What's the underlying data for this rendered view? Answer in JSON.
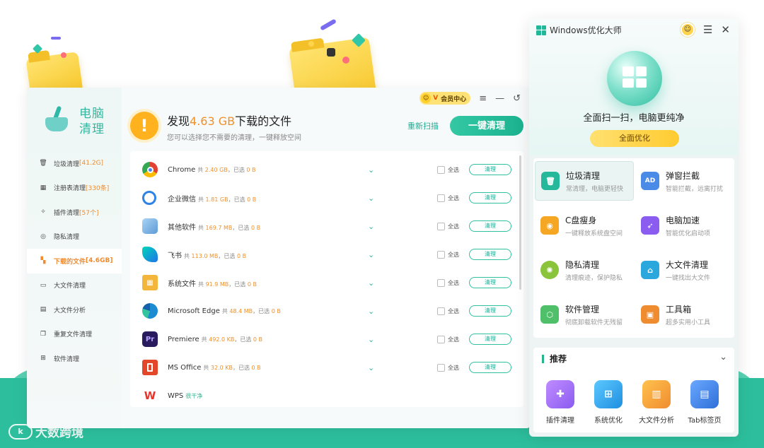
{
  "brand": {
    "logo_text": "k",
    "name": "大数跨境"
  },
  "main": {
    "app_name_line1": "电脑",
    "app_name_line2": "清理",
    "topbar": {
      "vip_badge": "V",
      "vip_label": "会员中心",
      "menu_icon": "≡",
      "minimize_icon": "—",
      "back_icon": "↺"
    },
    "sidebar": [
      {
        "label": "垃圾清理",
        "count": "[41.2G]",
        "icon": "trash-icon"
      },
      {
        "label": "注册表清理",
        "count": "[330条]",
        "icon": "registry-icon"
      },
      {
        "label": "插件清理",
        "count": "[57个]",
        "icon": "plugin-icon"
      },
      {
        "label": "隐私清理",
        "count": "",
        "icon": "privacy-icon"
      },
      {
        "label": "下载的文件",
        "count": "[4.6GB]",
        "icon": "download-icon"
      },
      {
        "label": "大文件清理",
        "count": "",
        "icon": "folder-icon"
      },
      {
        "label": "大文件分析",
        "count": "",
        "icon": "chart-icon"
      },
      {
        "label": "重复文件清理",
        "count": "",
        "icon": "duplicate-icon"
      },
      {
        "label": "软件清理",
        "count": "",
        "icon": "software-icon"
      }
    ],
    "header": {
      "title_prefix": "发现",
      "title_size": "4.63 GB",
      "title_suffix": "下载的文件",
      "subtitle": "您可以选择您不需要的清理，一键释放空间",
      "rescan": "重新扫描",
      "clean_all": "一键清理"
    },
    "rows": [
      {
        "name": "Chrome",
        "total_label": "共",
        "total": "2.40 GB",
        "sep": "，",
        "selected_label": "已选",
        "selected": "0 B",
        "select_all": "全选",
        "clean": "清理",
        "icon_text": "",
        "color": "#e34133"
      },
      {
        "name": "企业微信",
        "total_label": "共",
        "total": "1.81 GB",
        "sep": "，",
        "selected_label": "已选",
        "selected": "0 B",
        "select_all": "全选",
        "clean": "清理",
        "icon_text": "",
        "color": "#2f83e6"
      },
      {
        "name": "其他软件",
        "total_label": "共",
        "total": "169.7 MB",
        "sep": "，",
        "selected_label": "已选",
        "selected": "0 B",
        "select_all": "全选",
        "clean": "清理",
        "icon_text": "",
        "color": "#7eb5e4"
      },
      {
        "name": "飞书",
        "total_label": "共",
        "total": "113.0 MB",
        "sep": "，",
        "selected_label": "已选",
        "selected": "0 B",
        "select_all": "全选",
        "clean": "清理",
        "icon_text": "",
        "color": "#1f74e8"
      },
      {
        "name": "系统文件",
        "total_label": "共",
        "total": "91.9 MB",
        "sep": "，",
        "selected_label": "已选",
        "selected": "0 B",
        "select_all": "全选",
        "clean": "清理",
        "icon_text": "",
        "color": "#f3b53a"
      },
      {
        "name": "Microsoft Edge",
        "total_label": "共",
        "total": "48.4 MB",
        "sep": "，",
        "selected_label": "已选",
        "selected": "0 B",
        "select_all": "全选",
        "clean": "清理",
        "icon_text": "",
        "color": "#1d8bd1"
      },
      {
        "name": "Premiere",
        "total_label": "共",
        "total": "492.0 KB",
        "sep": "，",
        "selected_label": "已选",
        "selected": "0 B",
        "select_all": "全选",
        "clean": "清理",
        "icon_text": "Pr",
        "color": "#2a1b5e"
      },
      {
        "name": "MS Office",
        "total_label": "共",
        "total": "32.0 KB",
        "sep": "，",
        "selected_label": "已选",
        "selected": "0 B",
        "select_all": "全选",
        "clean": "清理",
        "icon_text": "",
        "color": "#e2472a"
      },
      {
        "name": "WPS",
        "status": "很干净",
        "icon_text": "W",
        "color": "#e8352b"
      }
    ]
  },
  "right": {
    "title": "Windows优化大师",
    "slogan": "全面扫一扫，电脑更纯净",
    "optimize": "全面优化",
    "features": [
      {
        "title": "垃圾清理",
        "desc": "常清理，电脑更轻快",
        "color": "#26b89a",
        "icon": "trash-can-icon"
      },
      {
        "title": "弹窗拦截",
        "desc": "智能拦截，远离打扰",
        "color": "#4a8be8",
        "icon": "ad-block-icon",
        "icon_text": "AD"
      },
      {
        "title": "C盘瘦身",
        "desc": "一键释放系统盘空间",
        "color": "#f5a623",
        "icon": "disk-slim-icon"
      },
      {
        "title": "电脑加速",
        "desc": "智能优化启动项",
        "color": "#8a5cf0",
        "icon": "rocket-icon"
      },
      {
        "title": "隐私清理",
        "desc": "清理痕迹，保护隐私",
        "color": "#8ac43a",
        "icon": "film-reel-icon"
      },
      {
        "title": "大文件清理",
        "desc": "一键找出大文件",
        "color": "#2aa8de",
        "icon": "broom-icon"
      },
      {
        "title": "软件管理",
        "desc": "彻底卸载软件无残留",
        "color": "#4fbf6a",
        "icon": "cube-icon"
      },
      {
        "title": "工具箱",
        "desc": "超多实用小工具",
        "color": "#f08c30",
        "icon": "toolbox-icon"
      }
    ],
    "recommend": {
      "title": "推荐",
      "items": [
        {
          "label": "插件清理",
          "color": "#a06cf2",
          "icon": "puzzle-icon"
        },
        {
          "label": "系统优化",
          "color": "#2aa8ee",
          "icon": "windows-icon"
        },
        {
          "label": "大文件分析",
          "color": "#f5a623",
          "icon": "file-chart-icon"
        },
        {
          "label": "Tab标签页",
          "color": "#3a87e8",
          "icon": "tab-page-icon"
        }
      ]
    }
  }
}
